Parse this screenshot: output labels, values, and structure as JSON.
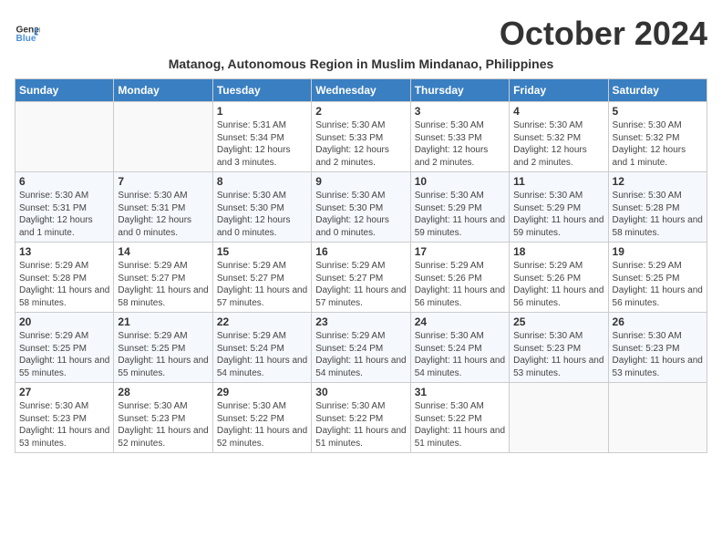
{
  "logo": {
    "line1": "General",
    "line2": "Blue"
  },
  "title": "October 2024",
  "subtitle": "Matanog, Autonomous Region in Muslim Mindanao, Philippines",
  "days_of_week": [
    "Sunday",
    "Monday",
    "Tuesday",
    "Wednesday",
    "Thursday",
    "Friday",
    "Saturday"
  ],
  "weeks": [
    [
      {
        "day": "",
        "content": ""
      },
      {
        "day": "",
        "content": ""
      },
      {
        "day": "1",
        "content": "Sunrise: 5:31 AM\nSunset: 5:34 PM\nDaylight: 12 hours and 3 minutes."
      },
      {
        "day": "2",
        "content": "Sunrise: 5:30 AM\nSunset: 5:33 PM\nDaylight: 12 hours and 2 minutes."
      },
      {
        "day": "3",
        "content": "Sunrise: 5:30 AM\nSunset: 5:33 PM\nDaylight: 12 hours and 2 minutes."
      },
      {
        "day": "4",
        "content": "Sunrise: 5:30 AM\nSunset: 5:32 PM\nDaylight: 12 hours and 2 minutes."
      },
      {
        "day": "5",
        "content": "Sunrise: 5:30 AM\nSunset: 5:32 PM\nDaylight: 12 hours and 1 minute."
      }
    ],
    [
      {
        "day": "6",
        "content": "Sunrise: 5:30 AM\nSunset: 5:31 PM\nDaylight: 12 hours and 1 minute."
      },
      {
        "day": "7",
        "content": "Sunrise: 5:30 AM\nSunset: 5:31 PM\nDaylight: 12 hours and 0 minutes."
      },
      {
        "day": "8",
        "content": "Sunrise: 5:30 AM\nSunset: 5:30 PM\nDaylight: 12 hours and 0 minutes."
      },
      {
        "day": "9",
        "content": "Sunrise: 5:30 AM\nSunset: 5:30 PM\nDaylight: 12 hours and 0 minutes."
      },
      {
        "day": "10",
        "content": "Sunrise: 5:30 AM\nSunset: 5:29 PM\nDaylight: 11 hours and 59 minutes."
      },
      {
        "day": "11",
        "content": "Sunrise: 5:30 AM\nSunset: 5:29 PM\nDaylight: 11 hours and 59 minutes."
      },
      {
        "day": "12",
        "content": "Sunrise: 5:30 AM\nSunset: 5:28 PM\nDaylight: 11 hours and 58 minutes."
      }
    ],
    [
      {
        "day": "13",
        "content": "Sunrise: 5:29 AM\nSunset: 5:28 PM\nDaylight: 11 hours and 58 minutes."
      },
      {
        "day": "14",
        "content": "Sunrise: 5:29 AM\nSunset: 5:27 PM\nDaylight: 11 hours and 58 minutes."
      },
      {
        "day": "15",
        "content": "Sunrise: 5:29 AM\nSunset: 5:27 PM\nDaylight: 11 hours and 57 minutes."
      },
      {
        "day": "16",
        "content": "Sunrise: 5:29 AM\nSunset: 5:27 PM\nDaylight: 11 hours and 57 minutes."
      },
      {
        "day": "17",
        "content": "Sunrise: 5:29 AM\nSunset: 5:26 PM\nDaylight: 11 hours and 56 minutes."
      },
      {
        "day": "18",
        "content": "Sunrise: 5:29 AM\nSunset: 5:26 PM\nDaylight: 11 hours and 56 minutes."
      },
      {
        "day": "19",
        "content": "Sunrise: 5:29 AM\nSunset: 5:25 PM\nDaylight: 11 hours and 56 minutes."
      }
    ],
    [
      {
        "day": "20",
        "content": "Sunrise: 5:29 AM\nSunset: 5:25 PM\nDaylight: 11 hours and 55 minutes."
      },
      {
        "day": "21",
        "content": "Sunrise: 5:29 AM\nSunset: 5:25 PM\nDaylight: 11 hours and 55 minutes."
      },
      {
        "day": "22",
        "content": "Sunrise: 5:29 AM\nSunset: 5:24 PM\nDaylight: 11 hours and 54 minutes."
      },
      {
        "day": "23",
        "content": "Sunrise: 5:29 AM\nSunset: 5:24 PM\nDaylight: 11 hours and 54 minutes."
      },
      {
        "day": "24",
        "content": "Sunrise: 5:30 AM\nSunset: 5:24 PM\nDaylight: 11 hours and 54 minutes."
      },
      {
        "day": "25",
        "content": "Sunrise: 5:30 AM\nSunset: 5:23 PM\nDaylight: 11 hours and 53 minutes."
      },
      {
        "day": "26",
        "content": "Sunrise: 5:30 AM\nSunset: 5:23 PM\nDaylight: 11 hours and 53 minutes."
      }
    ],
    [
      {
        "day": "27",
        "content": "Sunrise: 5:30 AM\nSunset: 5:23 PM\nDaylight: 11 hours and 53 minutes."
      },
      {
        "day": "28",
        "content": "Sunrise: 5:30 AM\nSunset: 5:23 PM\nDaylight: 11 hours and 52 minutes."
      },
      {
        "day": "29",
        "content": "Sunrise: 5:30 AM\nSunset: 5:22 PM\nDaylight: 11 hours and 52 minutes."
      },
      {
        "day": "30",
        "content": "Sunrise: 5:30 AM\nSunset: 5:22 PM\nDaylight: 11 hours and 51 minutes."
      },
      {
        "day": "31",
        "content": "Sunrise: 5:30 AM\nSunset: 5:22 PM\nDaylight: 11 hours and 51 minutes."
      },
      {
        "day": "",
        "content": ""
      },
      {
        "day": "",
        "content": ""
      }
    ]
  ]
}
